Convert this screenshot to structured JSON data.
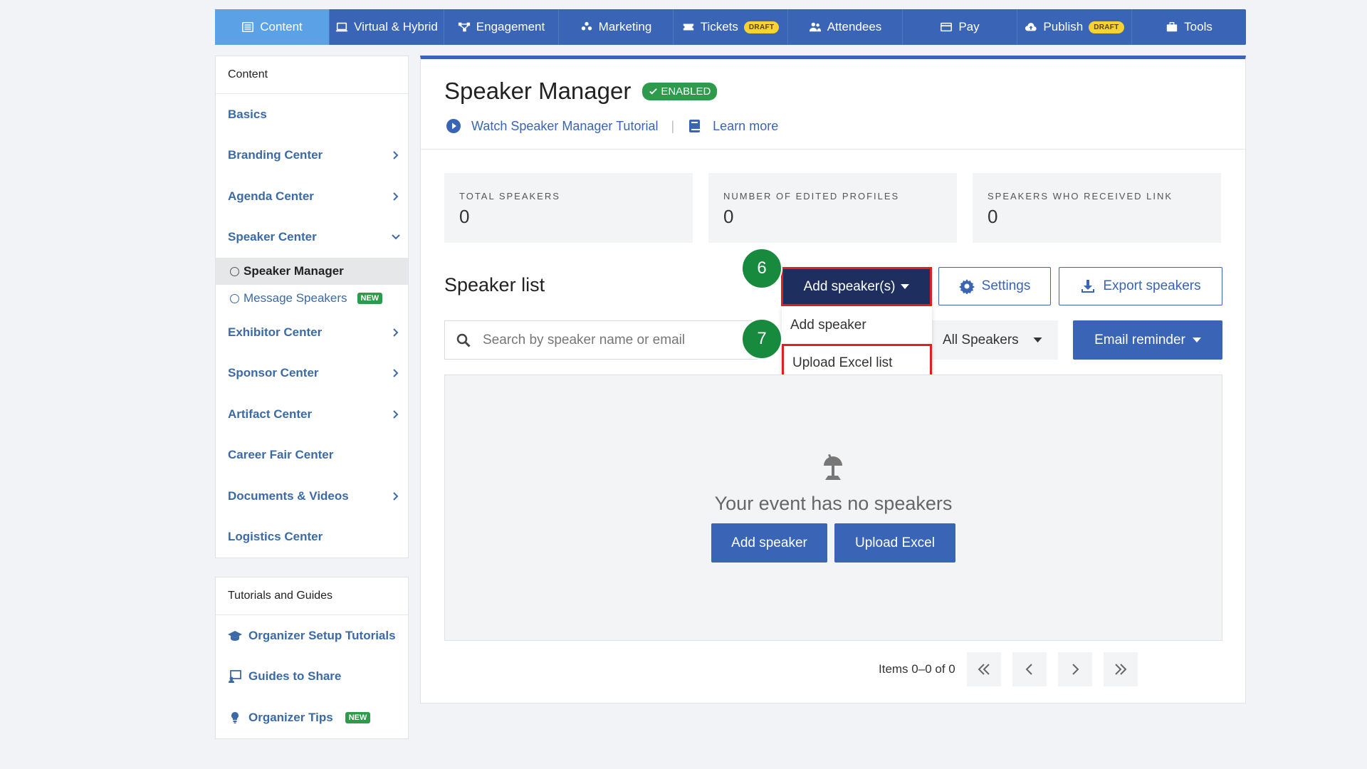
{
  "nav": {
    "items": [
      {
        "label": "Content",
        "icon": "list-icon",
        "active": true
      },
      {
        "label": "Virtual & Hybrid",
        "icon": "laptop-icon"
      },
      {
        "label": "Engagement",
        "icon": "network-icon"
      },
      {
        "label": "Marketing",
        "icon": "people-group-icon"
      },
      {
        "label": "Tickets",
        "icon": "ticket-icon",
        "badge": "DRAFT"
      },
      {
        "label": "Attendees",
        "icon": "users-icon"
      },
      {
        "label": "Pay",
        "icon": "credit-card-icon"
      },
      {
        "label": "Publish",
        "icon": "cloud-upload-icon",
        "badge": "DRAFT"
      },
      {
        "label": "Tools",
        "icon": "toolbox-icon"
      }
    ]
  },
  "sidebar": {
    "header": "Content",
    "items": [
      {
        "label": "Basics"
      },
      {
        "label": "Branding Center"
      },
      {
        "label": "Agenda Center"
      },
      {
        "label": "Speaker Center"
      },
      {
        "label": "Speaker Manager"
      },
      {
        "label": "Message Speakers",
        "badge": "NEW"
      },
      {
        "label": "Exhibitor Center"
      },
      {
        "label": "Sponsor Center"
      },
      {
        "label": "Artifact Center"
      },
      {
        "label": "Career Fair Center"
      },
      {
        "label": "Documents & Videos"
      },
      {
        "label": "Logistics Center"
      }
    ]
  },
  "tutorials": {
    "header": "Tutorials and Guides",
    "items": [
      {
        "label": "Organizer Setup Tutorials"
      },
      {
        "label": "Guides to Share"
      },
      {
        "label": "Organizer Tips",
        "badge": "NEW"
      }
    ]
  },
  "main": {
    "title": "Speaker Manager",
    "status": "ENABLED",
    "tutorial_link": "Watch Speaker Manager Tutorial",
    "learn_link": "Learn more",
    "stats": [
      {
        "label": "TOTAL SPEAKERS",
        "value": "0"
      },
      {
        "label": "NUMBER OF EDITED PROFILES",
        "value": "0"
      },
      {
        "label": "SPEAKERS WHO RECEIVED LINK",
        "value": "0"
      }
    ],
    "list_title": "Speaker list",
    "add_button": "Add speaker(s)",
    "settings_button": "Settings",
    "export_button": "Export speakers",
    "search_placeholder": "Search by speaker name or email",
    "filter_value": "All Speakers",
    "email_button": "Email reminder",
    "dropdown": [
      "Add speaker",
      "Upload Excel list"
    ],
    "empty_text": "Your event has no speakers",
    "empty_add": "Add speaker",
    "empty_upload": "Upload Excel",
    "pager_text": "Items 0–0 of 0"
  },
  "steps": [
    "6",
    "7"
  ],
  "colors": {
    "nav": "#3a64b5",
    "active_nav": "#5aa1e6",
    "badge_green": "#2e9a4b",
    "step_green": "#178a3e",
    "highlight": "#e02020",
    "draft": "#f8d231"
  }
}
